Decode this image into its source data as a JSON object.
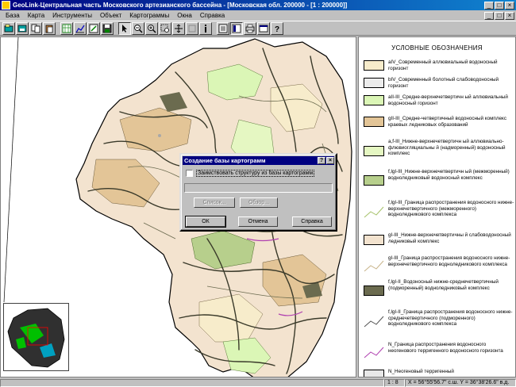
{
  "window": {
    "title": "GeoLink-Центральная часть Московского артезианского бассейна - [Московская обл. 200000 - [1 : 200000]]",
    "minimize": "_",
    "maximize": "□",
    "close": "×"
  },
  "menu": {
    "items": [
      "База",
      "Карта",
      "Инструменты",
      "Объект",
      "Картограммы",
      "Окна",
      "Справка"
    ]
  },
  "toolbar": {
    "icons": [
      "open-db-icon",
      "save-db-icon",
      "copy-icon",
      "paste-icon",
      "grid-icon",
      "chart-icon",
      "edit-chart-icon",
      "save-icon",
      "pointer-icon",
      "zoom-out-icon",
      "zoom-in-icon",
      "zoom-rect-icon",
      "pan-icon",
      "disabled-tool-icon",
      "info-icon",
      "layers-icon",
      "legend-icon",
      "print-icon",
      "export-icon",
      "help-icon"
    ]
  },
  "legend": {
    "title": "УСЛОВНЫЕ ОБОЗНАЧЕНИЯ",
    "items": [
      {
        "kind": "fill",
        "color": "#f7eccb",
        "text": "aIV_Современный аллювиальный водоносный горизонт"
      },
      {
        "kind": "fill",
        "color": "#ececec",
        "text": "bIV_Современный болотный слабоводоносный горизонт"
      },
      {
        "kind": "fill",
        "color": "#dbf6b6",
        "text": "aII-III_Средне-верхнечетвертичн ый аллювиальный водоносный горизонт"
      },
      {
        "kind": "fill",
        "color": "#e3c597",
        "text": "gII-III_Средне-четвертичный водоносный комплекс краевых ледниковых образований"
      },
      {
        "kind": "fill",
        "color": "#e5f7c2",
        "text": "a,f-III_Нижне-верхнечетвертичн ый аллювиально-флювиогляциальны й (надморенный) водоносный комплекс"
      },
      {
        "kind": "fill",
        "color": "#b7cf8c",
        "text": "f,lgI-III_Нижне-верхнечетвертичн ый (межморенный) водноледниковый водоносный комплекс"
      },
      {
        "kind": "line",
        "color": "#a6c26a",
        "text": "f,lgI-III_Граница распространения водоносного нижне-верхнечетвертичного (межморенного) водноледникового комплекса"
      },
      {
        "kind": "fill",
        "color": "#f3e3cf",
        "text": "gI-III_Нижне-верхнечетвертичны й слабоводоносный ледниковый комплекс"
      },
      {
        "kind": "line",
        "color": "#c8b48a",
        "text": "gI-III_Граница распространения водоносного нижне-верхнечетвертичного водноледникового комплекса"
      },
      {
        "kind": "fill",
        "color": "#6b6b4f",
        "text": "f,lgI-II_Водоносный нижне-среднечетвертичный (подморенный) водноледниковый комплекс"
      },
      {
        "kind": "line",
        "color": "#555555",
        "text": "f,lgI-II_Граница распространения водоносного нижне-среднечетвертичного (подморенного) водноледникового комплекса"
      },
      {
        "kind": "line",
        "color": "#b040b0",
        "text": "N_Граница распространения водоносного неогенового терригенного водоносного горизонта"
      },
      {
        "kind": "fill",
        "color": "#e8e8e8",
        "text": "N_Неогеновый терригенный"
      }
    ]
  },
  "dialog": {
    "title": "Создание базы картограмм",
    "help_btn": "?",
    "close_btn": "×",
    "checkbox_label": "Заимствовать структуру из базы картограмм",
    "select_button": "Список...",
    "browse_button": "Обзор...",
    "ok_button": "ОК",
    "cancel_button": "Отмена",
    "help_button": "Справка"
  },
  "status": {
    "scale": "1 : 8",
    "coords": "X = 56°55'56.7\" с.ш.  Y = 36°38'26.6\" в.д."
  }
}
